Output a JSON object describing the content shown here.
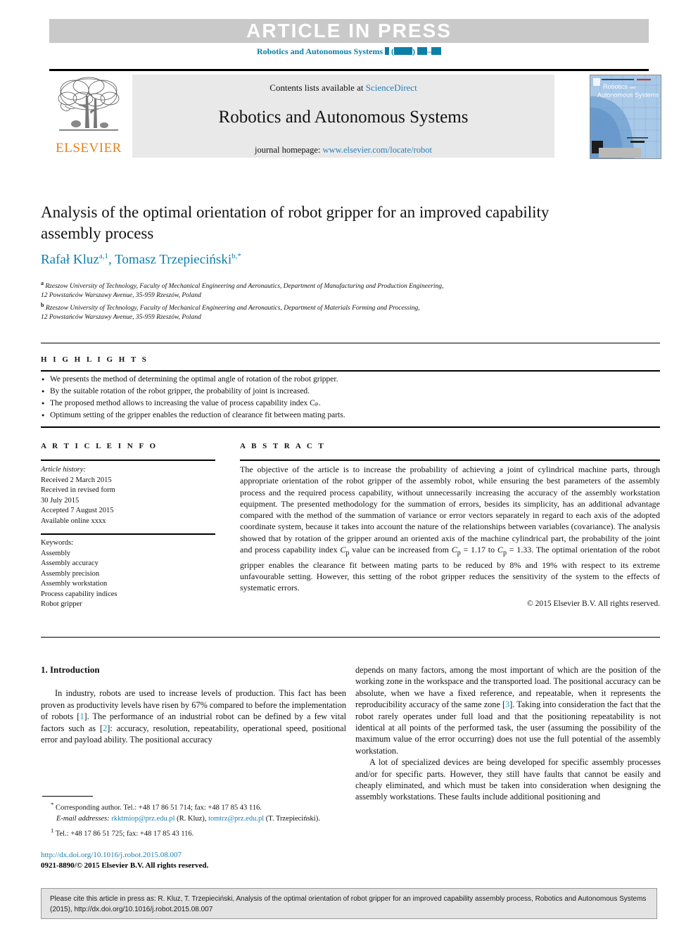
{
  "banner": {
    "article_in_press": "ARTICLE  IN  PRESS",
    "journal_ref_prefix": "Robotics and Autonomous Systems"
  },
  "masthead": {
    "contents_prefix": "Contents lists available at ",
    "sciencedirect": "ScienceDirect",
    "journal_name": "Robotics and Autonomous Systems",
    "homepage_prefix": "journal homepage: ",
    "homepage_url": "www.elsevier.com/locate/robot",
    "publisher": "ELSEVIER",
    "cover_title_line1": "Robotics and",
    "cover_title_line2": "Autonomous Systems"
  },
  "article": {
    "title": "Analysis of the optimal orientation of robot gripper for an improved capability assembly process",
    "authors": "Rafał Kluz",
    "author1": "Rafał Kluz",
    "author1_sup": "a,1",
    "author2": "Tomasz Trzepieciński",
    "author2_sup": "b,*",
    "affiliation_a_sup": "a",
    "affiliation_a_line1": "Rzeszow University of Technology, Faculty of Mechanical Engineering and Aeronautics, Department of Manufacturing and Production Engineering,",
    "affiliation_a_line2": "12 Powstańców Warszawy Avenue, 35-959 Rzeszów, Poland",
    "affiliation_b_sup": "b",
    "affiliation_b_line1": "Rzeszow University of Technology, Faculty of Mechanical Engineering and Aeronautics, Department of Materials Forming and Processing,",
    "affiliation_b_line2": "12 Powstańców Warszawy Avenue, 35-959 Rzeszów, Poland"
  },
  "highlights": {
    "heading": "H I G H L I G H T S",
    "items": [
      "We presents the method of determining the optimal angle of rotation of the robot gripper.",
      "By the suitable rotation of the robot gripper, the probability of joint is increased.",
      "The proposed method allows to increasing the value of process capability index Cₚ.",
      "Optimum setting of the gripper enables the reduction of clearance fit between mating parts."
    ]
  },
  "article_info": {
    "heading": "A R T I C L E   I N F O",
    "history_label": "Article history:",
    "received": "Received 2 March 2015",
    "revised_label": "Received in revised form",
    "revised_date": "30 July 2015",
    "accepted": "Accepted 7 August 2015",
    "available": "Available online xxxx",
    "keywords_label": "Keywords:",
    "keywords": [
      "Assembly",
      "Assembly accuracy",
      "Assembly precision",
      "Assembly workstation",
      "Process capability indices",
      "Robot gripper"
    ]
  },
  "abstract": {
    "heading": "A B S T R A C T",
    "text_part1": "The objective of the article is to increase the probability of achieving a joint of cylindrical machine parts, through appropriate orientation of the robot gripper of the assembly robot, while ensuring the best parameters of the assembly process and the required process capability, without unnecessarily increasing the accuracy of the assembly workstation equipment. The presented methodology for the summation of errors, besides its simplicity, has an additional advantage compared with the method of the summation of variance or error vectors separately in regard to each axis of the adopted coordinate system, because it takes into account the nature of the relationships between variables (covariance). The analysis showed that by rotation of the gripper around an oriented axis of the machine cylindrical part, the probability of the joint and process capability index ",
    "cp_1": "C",
    "cp_sub": "p",
    "text_part2": " value can be increased from ",
    "cp_eq1": " = 1.17 to ",
    "cp_eq2": " = 1.33. The optimal orientation of the robot gripper enables the clearance fit between mating parts to be reduced by 8% and 19% with respect to its extreme unfavourable setting. However, this setting of the robot gripper reduces the sensitivity of the system to the effects of systematic errors.",
    "copyright": "© 2015 Elsevier B.V. All rights reserved."
  },
  "body": {
    "section_number_title": "1.  Introduction",
    "left_p1_a": "In industry, robots are used to increase levels of production. This fact has been proven as productivity levels have risen by 67% compared to before the implementation of robots [",
    "left_ref1": "1",
    "left_p1_b": "]. The performance of an industrial robot can be defined by a few vital factors such as [",
    "left_ref2": "2",
    "left_p1_c": "]: accuracy, resolution, repeatability, operational speed, positional error and payload ability. The positional accuracy",
    "right_p1_a": "depends on many factors, among the most important of which are the position of the working zone in the workspace and the transported load. The positional accuracy can be absolute, when we have a fixed reference, and repeatable, when it represents the reproducibility accuracy of the same zone [",
    "right_ref3": "3",
    "right_p1_b": "]. Taking into consideration the fact that the robot rarely operates under full load and that the positioning repeatability is not identical at all points of the performed task, the user (assuming the possibility of the maximum value of the error occurring) does not use the full potential of the assembly workstation.",
    "right_p2": "A lot of specialized devices are being developed for specific assembly processes and/or for specific parts. However, they still have faults that cannot be easily and cheaply eliminated, and which must be taken into consideration when designing the assembly workstations. These faults include additional positioning and"
  },
  "footnotes": {
    "corresponding_marker": "*",
    "corresponding": "Corresponding author. Tel.: +48 17 86 51 714; fax: +48 17 85 43 116.",
    "email_label": "E-mail addresses:",
    "email1": "rkktmiop@prz.edu.pl",
    "email1_owner": "(R. Kluz),",
    "email2": "tomtrz@prz.edu.pl",
    "email2_owner": "(T. Trzepieciński).",
    "note1_marker": "1",
    "note1": "Tel.: +48 17 86 51 725; fax: +48 17 85 43 116.",
    "doi_url": "http://dx.doi.org/10.1016/j.robot.2015.08.007",
    "issn_line": "0921-8890/© 2015 Elsevier B.V. All rights reserved."
  },
  "citation": {
    "text": "Please cite this article in press as: R. Kluz, T. Trzepieciński, Analysis of the optimal orientation of robot gripper for an improved capability assembly process, Robotics and Autonomous Systems (2015), http://dx.doi.org/10.1016/j.robot.2015.08.007"
  },
  "colors": {
    "accent_blue": "#0b7fa8",
    "link_blue": "#2a7fb8",
    "elsevier_orange": "#e8801a",
    "banner_gray": "#c9c9c9",
    "masthead_gray": "#e9e9e9"
  }
}
